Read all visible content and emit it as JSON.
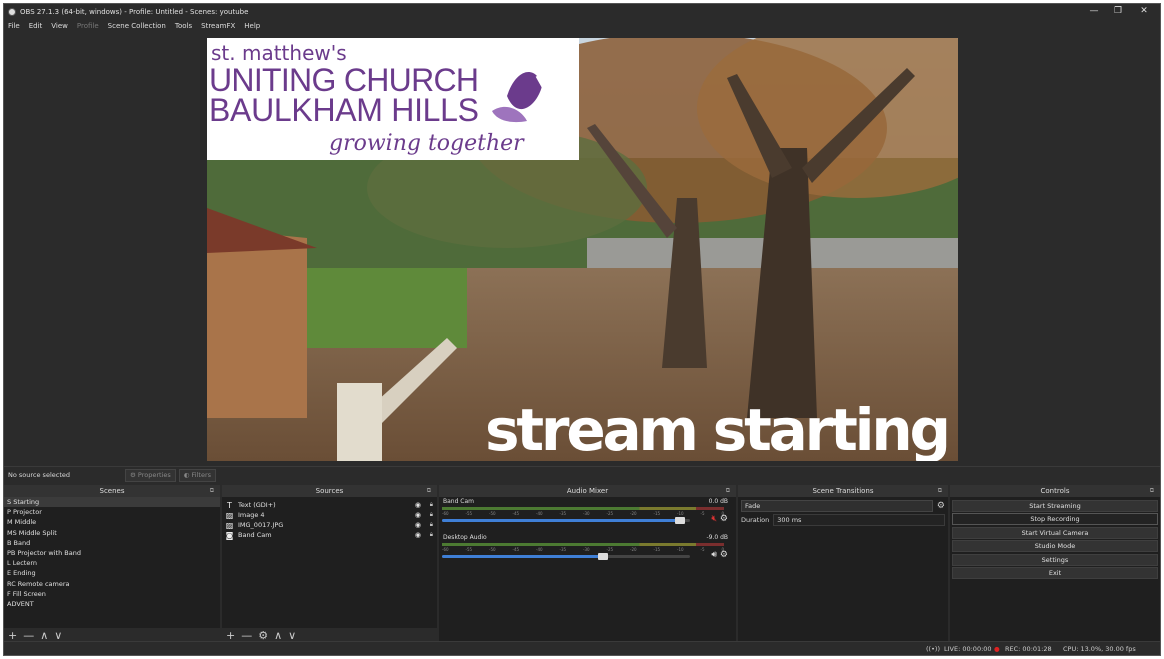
{
  "window": {
    "title": "OBS 27.1.3 (64-bit, windows) - Profile: Untitled - Scenes: youtube",
    "controls": {
      "minimize": "—",
      "maximize": "❐",
      "close": "✕"
    }
  },
  "menu": [
    "File",
    "Edit",
    "View",
    "Profile",
    "Scene Collection",
    "Tools",
    "StreamFX",
    "Help"
  ],
  "preview": {
    "logo_line1": "st. matthew's",
    "logo_line2": "UNITING CHURCH",
    "logo_line3": "BAULKHAM HILLS",
    "logo_line4": "growing together",
    "overlay_text": "stream starting",
    "logo_color": "#6b3b8c"
  },
  "source_toolbar": {
    "no_source": "No source selected",
    "properties": "Properties",
    "filters": "Filters"
  },
  "scenes": {
    "title": "Scenes",
    "items": [
      "S  Starting",
      "P  Projector",
      "M  Middle",
      "MS  Middle Split",
      "B  Band",
      "PB  Projector with Band",
      "L  Lectern",
      "E  Ending",
      "RC  Remote camera",
      "F  Fill Screen",
      "ADVENT"
    ],
    "footer": [
      "+",
      "—",
      "∧",
      "∨"
    ]
  },
  "sources": {
    "title": "Sources",
    "items": [
      {
        "icon": "T",
        "label": "Text (GDI+)"
      },
      {
        "icon": "▨",
        "label": "Image 4"
      },
      {
        "icon": "▨",
        "label": "IMG_0017.JPG"
      },
      {
        "icon": "◙",
        "label": "Band Cam"
      }
    ],
    "footer": [
      "+",
      "—",
      "⚙",
      "∧",
      "∨"
    ]
  },
  "audio_mixer": {
    "title": "Audio Mixer",
    "channels": [
      {
        "name": "Band Cam",
        "db": "0.0 dB",
        "volume_fraction": 0.98,
        "muted": true
      },
      {
        "name": "Desktop Audio",
        "db": "-9.0 dB",
        "volume_fraction": 0.67,
        "muted": false
      }
    ],
    "ticks": [
      "-60",
      "-55",
      "-50",
      "-45",
      "-40",
      "-35",
      "-30",
      "-25",
      "-20",
      "-15",
      "-10",
      "-5",
      "0"
    ]
  },
  "scene_transitions": {
    "title": "Scene Transitions",
    "transition": "Fade",
    "duration_label": "Duration",
    "duration_value": "300 ms"
  },
  "controls": {
    "title": "Controls",
    "buttons": [
      "Start Streaming",
      "Stop Recording",
      "Start Virtual Camera",
      "Studio Mode",
      "Settings",
      "Exit"
    ]
  },
  "status": {
    "live": "LIVE: 00:00:00",
    "rec": "REC: 00:01:28",
    "cpu": "CPU: 13.0%, 30.00 fps"
  }
}
